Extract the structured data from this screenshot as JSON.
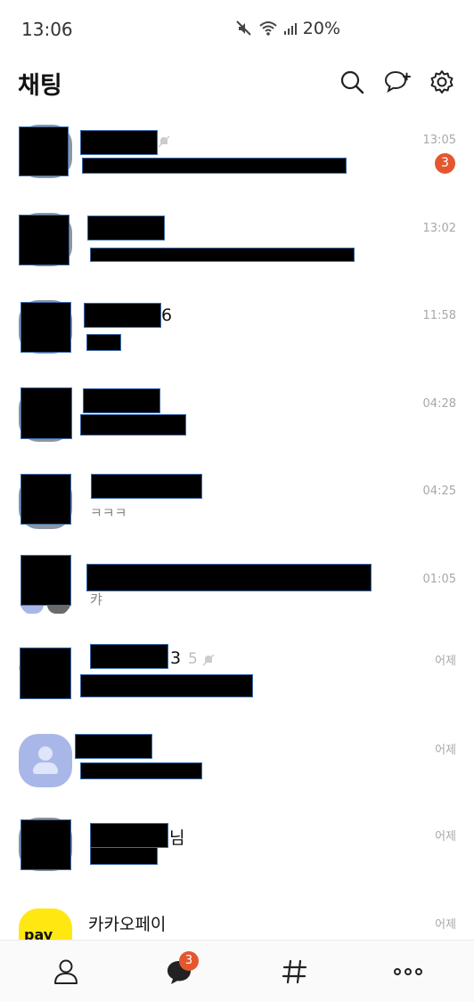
{
  "status_bar": {
    "time": "13:06",
    "battery": "20%"
  },
  "header": {
    "title": "채팅",
    "icons": [
      "search-icon",
      "new-chat-icon",
      "settings-icon"
    ]
  },
  "chats": [
    {
      "name_visible": "",
      "preview": "",
      "time": "13:05",
      "unread": "3",
      "muted": true
    },
    {
      "name_visible": "",
      "preview": "",
      "time": "13:02"
    },
    {
      "name_visible": "6",
      "preview": "",
      "time": "11:58"
    },
    {
      "name_visible": "",
      "preview": "",
      "time": "04:28"
    },
    {
      "name_visible": "",
      "preview": "ㅋㅋㅋ",
      "time": "04:25"
    },
    {
      "name_visible": "",
      "preview": "캬",
      "time": "01:05"
    },
    {
      "name_visible": "3",
      "member_count": "5",
      "preview": "",
      "time": "어제",
      "muted": true
    },
    {
      "name_visible": "",
      "preview": "",
      "time": "어제"
    },
    {
      "name_visible": "님",
      "preview": "",
      "time": "어제"
    },
    {
      "name_visible": "카카오페이",
      "preview": "",
      "time": "어제",
      "avatar_text": "pay"
    }
  ],
  "bottom_nav": {
    "items": [
      "friends-icon",
      "chats-icon",
      "openchat-icon",
      "more-icon"
    ],
    "chats_badge": "3"
  },
  "colors": {
    "badge": "#e4572e",
    "kakaopay_yellow": "#ffe812",
    "default_avatar": "#a9b7e8"
  }
}
